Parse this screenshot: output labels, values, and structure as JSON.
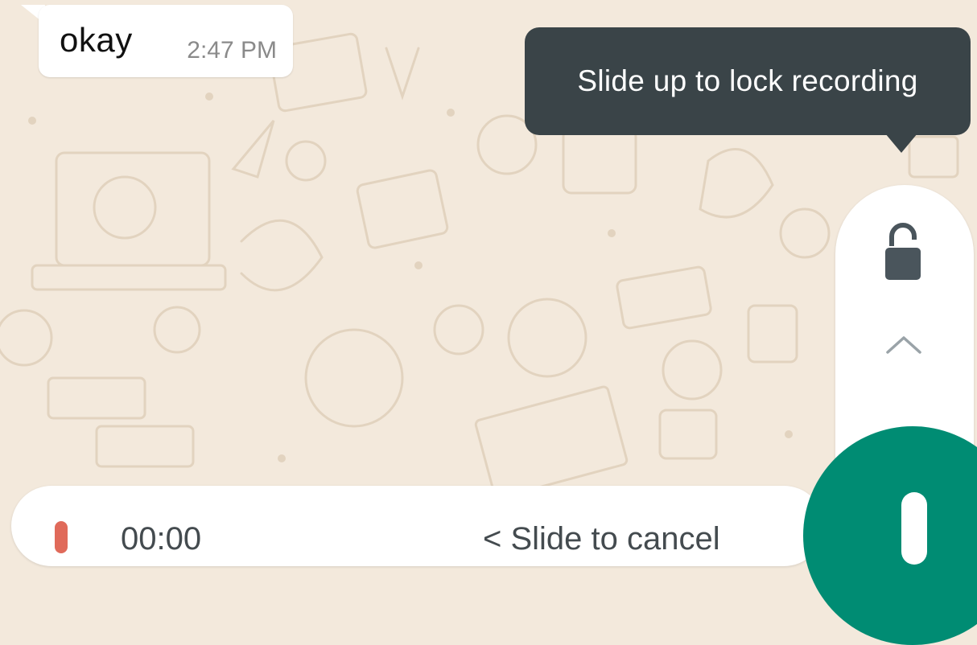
{
  "chat": {
    "message": {
      "text": "okay",
      "time": "2:47 PM"
    }
  },
  "tooltip": {
    "text": "Slide up to lock recording"
  },
  "lock_panel": {
    "lock_icon": "unlocked-padlock-icon",
    "arrow_icon": "chevron-up-icon"
  },
  "recording": {
    "timer": "00:00",
    "slide_hint": "< Slide to cancel",
    "mic_icon": "microphone-icon"
  },
  "colors": {
    "wallpaper": "#f3e9dc",
    "bubble": "#ffffff",
    "tooltip": "#3a4448",
    "mic_button": "#008c73",
    "recording_dot": "#e06a5a"
  }
}
